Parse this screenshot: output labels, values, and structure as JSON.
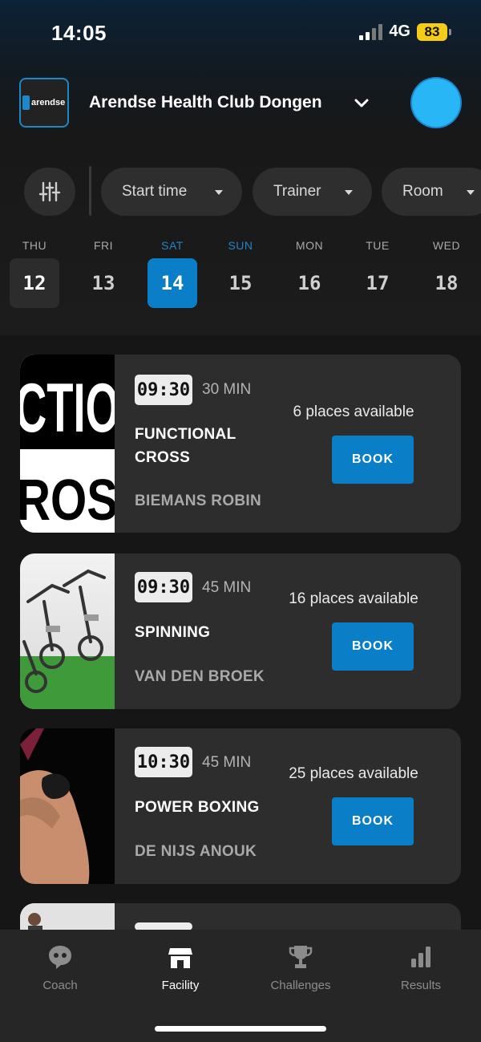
{
  "status_bar": {
    "time": "14:05",
    "network": "4G",
    "battery": "83"
  },
  "header": {
    "club_name": "Arendse Health Club Dongen",
    "logo_text": "arendse"
  },
  "filters": {
    "start_time": "Start time",
    "trainer": "Trainer",
    "room": "Room"
  },
  "days": [
    {
      "name": "THU",
      "num": "12",
      "state": "today"
    },
    {
      "name": "FRI",
      "num": "13",
      "state": ""
    },
    {
      "name": "SAT",
      "num": "14",
      "state": "active"
    },
    {
      "name": "SUN",
      "num": "15",
      "state": "weekend"
    },
    {
      "name": "MON",
      "num": "16",
      "state": ""
    },
    {
      "name": "TUE",
      "num": "17",
      "state": ""
    },
    {
      "name": "WED",
      "num": "18",
      "state": ""
    }
  ],
  "classes": [
    {
      "time": "09:30",
      "duration": "30 MIN",
      "name": "FUNCTIONAL CROSS",
      "trainer": "BIEMANS ROBIN",
      "places": "6 places available",
      "book": "BOOK",
      "image_text": "CTIO ROS"
    },
    {
      "time": "09:30",
      "duration": "45 MIN",
      "name": "SPINNING",
      "trainer": "VAN DEN BROEK",
      "places": "16 places available",
      "book": "BOOK"
    },
    {
      "time": "10:30",
      "duration": "45 MIN",
      "name": "POWER BOXING",
      "trainer": "DE NIJS ANOUK",
      "places": "25 places available",
      "book": "BOOK"
    }
  ],
  "nav": [
    {
      "label": "Coach",
      "icon": "coach-icon",
      "active": false
    },
    {
      "label": "Facility",
      "icon": "facility-icon",
      "active": true
    },
    {
      "label": "Challenges",
      "icon": "trophy-icon",
      "active": false
    },
    {
      "label": "Results",
      "icon": "bar-chart-icon",
      "active": false
    }
  ],
  "colors": {
    "accent": "#0a7fc7",
    "avatar": "#29b6f6",
    "battery": "#f5cc18"
  }
}
